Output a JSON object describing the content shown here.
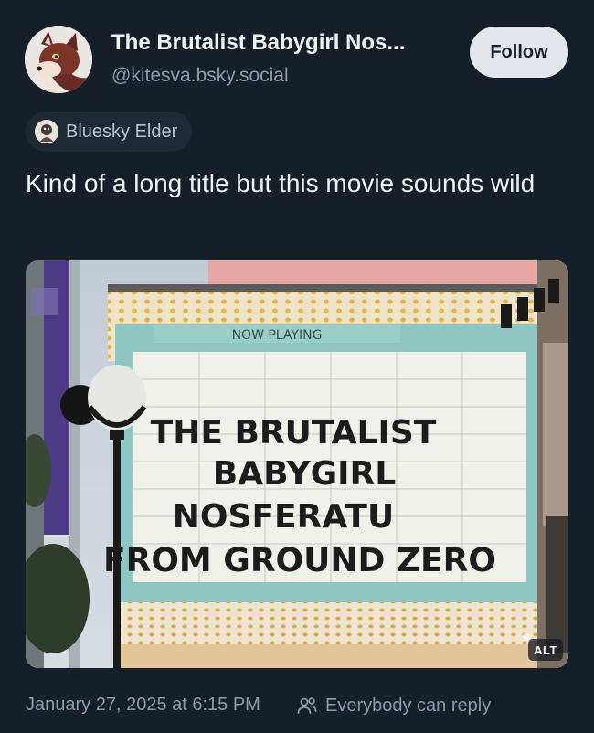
{
  "author": {
    "display_name": "The Brutalist Babygirl Nos...",
    "handle": "@kitesva.bsky.social",
    "avatar_icon": "fox-avatar"
  },
  "actions": {
    "follow_label": "Follow"
  },
  "badge": {
    "label": "Bluesky Elder",
    "icon": "elder-badge-icon"
  },
  "post": {
    "text": "Kind of a long title but this movie sounds wild"
  },
  "media": {
    "marquee_header": "NOW PLAYING",
    "marquee_lines": [
      "THE BRUTALIST",
      "BABYGIRL",
      "NOSFERATU",
      "FROM GROUND ZERO"
    ],
    "alt_label": "ALT"
  },
  "footer": {
    "timestamp": "January 27, 2025 at 6:15 PM",
    "reply_setting": "Everybody can reply",
    "reply_icon": "people-icon"
  },
  "colors": {
    "background": "#161e27",
    "text_primary": "#f1f3f5",
    "text_secondary": "#8d9aaa",
    "follow_button_bg": "#e3e6ea",
    "badge_bg": "#1f2934",
    "marquee_teal": "#8fc7c0"
  }
}
